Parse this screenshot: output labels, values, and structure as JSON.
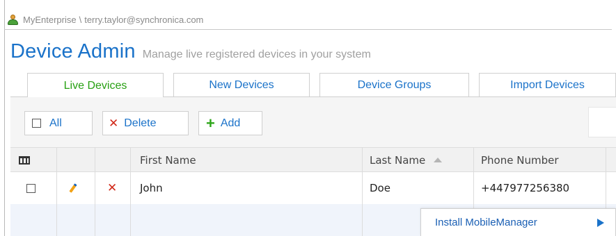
{
  "breadcrumb": {
    "enterprise": "MyEnterprise",
    "separator": "\\",
    "user": "terry.taylor@synchronica.com",
    "user_icon": "user-icon"
  },
  "header": {
    "title": "Device Admin",
    "subtitle": "Manage live registered devices in your system"
  },
  "tabs": [
    {
      "label": "Live Devices",
      "active": true
    },
    {
      "label": "New Devices",
      "active": false
    },
    {
      "label": "Device Groups",
      "active": false
    },
    {
      "label": "Import Devices",
      "active": false
    }
  ],
  "toolbar": {
    "all_label": "All",
    "delete_label": "Delete",
    "add_label": "Add"
  },
  "table": {
    "columns": [
      "",
      "",
      "",
      "First Name",
      "Last Name",
      "Phone Number"
    ],
    "sorted_column": "Last Name",
    "rows": [
      {
        "first_name": "John",
        "last_name": "Doe",
        "phone": "+447977256380"
      }
    ]
  },
  "popup": {
    "label": "Install MobileManager"
  },
  "colors": {
    "accent_blue": "#1a72c9",
    "active_tab_green": "#27a012",
    "delete_red": "#d12a1a",
    "add_green": "#2ea61a"
  }
}
